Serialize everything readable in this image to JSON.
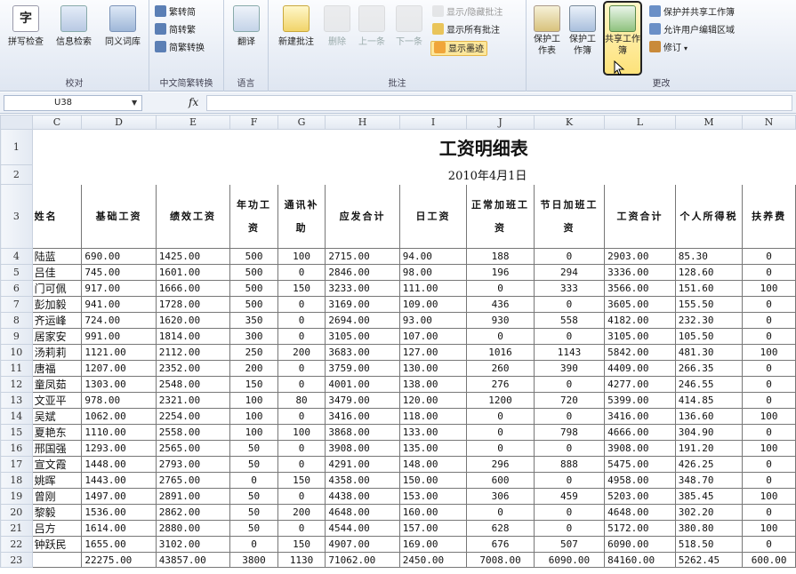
{
  "ribbon": {
    "proofing": {
      "label": "校对",
      "buttons": [
        "拼写检查",
        "信息检索",
        "同义词库"
      ]
    },
    "chinese_conversion": {
      "label": "中文简繁转换",
      "buttons": [
        "繁转简",
        "简转繁",
        "简繁转换"
      ]
    },
    "language": {
      "label": "语言",
      "buttons": [
        "翻译"
      ]
    },
    "comments": {
      "label": "批注",
      "big_buttons": [
        "新建批注",
        "删除",
        "上一条",
        "下一条"
      ],
      "small_buttons": [
        "显示/隐藏批注",
        "显示所有批注",
        "显示墨迹"
      ]
    },
    "changes": {
      "label": "更改",
      "big_buttons": [
        "保护工作表",
        "保护工作簿",
        "共享工作簿"
      ],
      "small_buttons": [
        "保护并共享工作簿",
        "允许用户编辑区域",
        "修订"
      ]
    }
  },
  "formula_bar": {
    "name_box": "U38",
    "fx": "fx",
    "value": ""
  },
  "columns": [
    "C",
    "D",
    "E",
    "F",
    "G",
    "H",
    "I",
    "J",
    "K",
    "L",
    "M",
    "N"
  ],
  "sheet": {
    "title": "工资明细表",
    "date": "2010年4月1日",
    "headers": [
      "姓名",
      "基础工资",
      "绩效工资",
      "年功工资",
      "通讯补助",
      "应发合计",
      "日工资",
      "正常加班工资",
      "节日加班工资",
      "工资合计",
      "个人所得税",
      "扶养费"
    ],
    "rows": [
      {
        "row": "4",
        "cells": [
          "陆蓝",
          "690.00",
          "1425.00",
          "500",
          "100",
          "2715.00",
          "94.00",
          "188",
          "0",
          "2903.00",
          "85.30",
          "0"
        ]
      },
      {
        "row": "5",
        "cells": [
          "吕佳",
          "745.00",
          "1601.00",
          "500",
          "0",
          "2846.00",
          "98.00",
          "196",
          "294",
          "3336.00",
          "128.60",
          "0"
        ]
      },
      {
        "row": "6",
        "cells": [
          "门可佩",
          "917.00",
          "1666.00",
          "500",
          "150",
          "3233.00",
          "111.00",
          "0",
          "333",
          "3566.00",
          "151.60",
          "100"
        ]
      },
      {
        "row": "7",
        "cells": [
          "彭加毅",
          "941.00",
          "1728.00",
          "500",
          "0",
          "3169.00",
          "109.00",
          "436",
          "0",
          "3605.00",
          "155.50",
          "0"
        ]
      },
      {
        "row": "8",
        "cells": [
          "齐运峰",
          "724.00",
          "1620.00",
          "350",
          "0",
          "2694.00",
          "93.00",
          "930",
          "558",
          "4182.00",
          "232.30",
          "0"
        ]
      },
      {
        "row": "9",
        "cells": [
          "居家安",
          "991.00",
          "1814.00",
          "300",
          "0",
          "3105.00",
          "107.00",
          "0",
          "0",
          "3105.00",
          "105.50",
          "0"
        ]
      },
      {
        "row": "10",
        "cells": [
          "汤莉莉",
          "1121.00",
          "2112.00",
          "250",
          "200",
          "3683.00",
          "127.00",
          "1016",
          "1143",
          "5842.00",
          "481.30",
          "100"
        ]
      },
      {
        "row": "11",
        "cells": [
          "唐福",
          "1207.00",
          "2352.00",
          "200",
          "0",
          "3759.00",
          "130.00",
          "260",
          "390",
          "4409.00",
          "266.35",
          "0"
        ]
      },
      {
        "row": "12",
        "cells": [
          "童凤茹",
          "1303.00",
          "2548.00",
          "150",
          "0",
          "4001.00",
          "138.00",
          "276",
          "0",
          "4277.00",
          "246.55",
          "0"
        ]
      },
      {
        "row": "13",
        "cells": [
          "文亚平",
          "978.00",
          "2321.00",
          "100",
          "80",
          "3479.00",
          "120.00",
          "1200",
          "720",
          "5399.00",
          "414.85",
          "0"
        ]
      },
      {
        "row": "14",
        "cells": [
          "吴斌",
          "1062.00",
          "2254.00",
          "100",
          "0",
          "3416.00",
          "118.00",
          "0",
          "0",
          "3416.00",
          "136.60",
          "100"
        ]
      },
      {
        "row": "15",
        "cells": [
          "夏艳东",
          "1110.00",
          "2558.00",
          "100",
          "100",
          "3868.00",
          "133.00",
          "0",
          "798",
          "4666.00",
          "304.90",
          "0"
        ]
      },
      {
        "row": "16",
        "cells": [
          "邢国强",
          "1293.00",
          "2565.00",
          "50",
          "0",
          "3908.00",
          "135.00",
          "0",
          "0",
          "3908.00",
          "191.20",
          "100"
        ]
      },
      {
        "row": "17",
        "cells": [
          "宣文霞",
          "1448.00",
          "2793.00",
          "50",
          "0",
          "4291.00",
          "148.00",
          "296",
          "888",
          "5475.00",
          "426.25",
          "0"
        ]
      },
      {
        "row": "18",
        "cells": [
          "姚晖",
          "1443.00",
          "2765.00",
          "0",
          "150",
          "4358.00",
          "150.00",
          "600",
          "0",
          "4958.00",
          "348.70",
          "0"
        ]
      },
      {
        "row": "19",
        "cells": [
          "曾刚",
          "1497.00",
          "2891.00",
          "50",
          "0",
          "4438.00",
          "153.00",
          "306",
          "459",
          "5203.00",
          "385.45",
          "100"
        ]
      },
      {
        "row": "20",
        "cells": [
          "黎毅",
          "1536.00",
          "2862.00",
          "50",
          "200",
          "4648.00",
          "160.00",
          "0",
          "0",
          "4648.00",
          "302.20",
          "0"
        ]
      },
      {
        "row": "21",
        "cells": [
          "吕方",
          "1614.00",
          "2880.00",
          "50",
          "0",
          "4544.00",
          "157.00",
          "628",
          "0",
          "5172.00",
          "380.80",
          "100"
        ]
      },
      {
        "row": "22",
        "cells": [
          "钟跃民",
          "1655.00",
          "3102.00",
          "0",
          "150",
          "4907.00",
          "169.00",
          "676",
          "507",
          "6090.00",
          "518.50",
          "0"
        ]
      },
      {
        "row": "23",
        "cells": [
          "",
          "22275.00",
          "43857.00",
          "3800",
          "1130",
          "71062.00",
          "2450.00",
          "7008.00",
          "6090.00",
          "84160.00",
          "5262.45",
          "600.00"
        ]
      }
    ]
  }
}
